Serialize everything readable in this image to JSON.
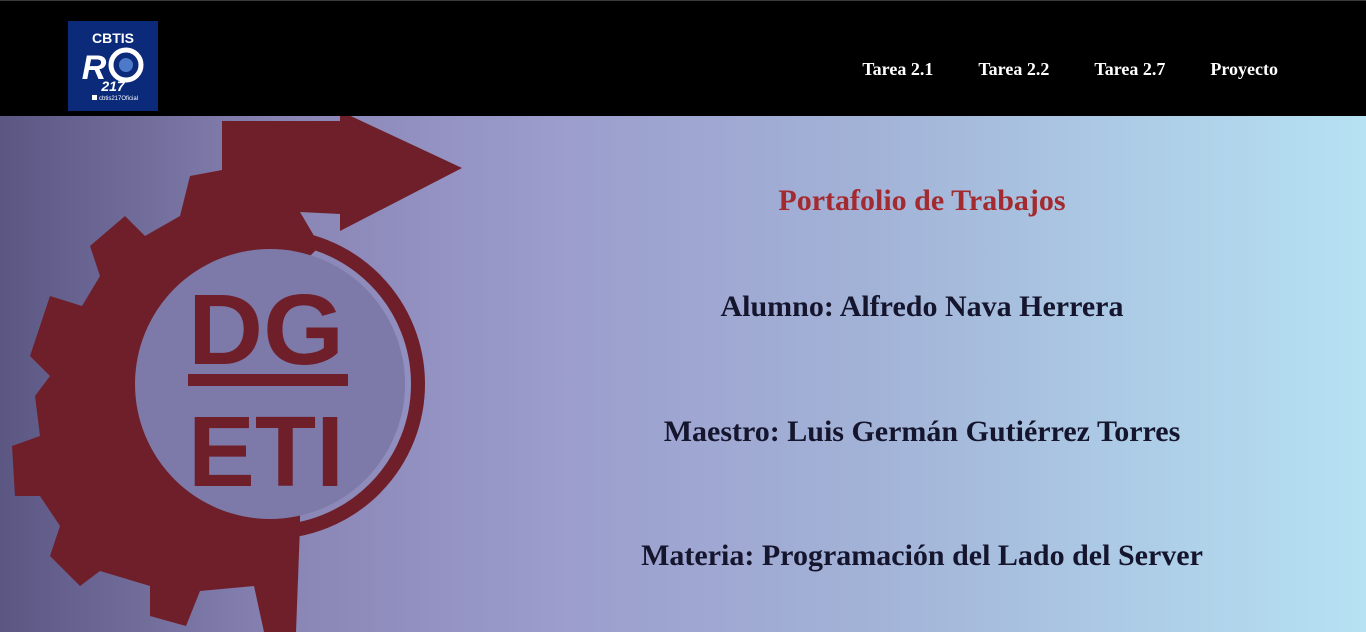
{
  "header": {
    "logo": {
      "text_top": "CBTIS",
      "text_number": "217",
      "text_bottom": "cbtis217Oficial"
    },
    "nav": [
      {
        "label": "Tarea 2.1"
      },
      {
        "label": "Tarea 2.2"
      },
      {
        "label": "Tarea 2.7"
      },
      {
        "label": "Proyecto"
      }
    ]
  },
  "hero": {
    "emblem_text": [
      "DG",
      "ETI"
    ],
    "title": "Portafolio de Trabajos",
    "alumno": {
      "label": "Alumno:",
      "value": "Alfredo Nava Herrera"
    },
    "maestro": {
      "label": "Maestro:",
      "value": "Luis Germán Gutiérrez Torres"
    },
    "materia": {
      "label": "Materia:",
      "value": "Programación del Lado del Server"
    }
  },
  "colors": {
    "topbar": "#000000",
    "title": "#a32a2e",
    "text": "#15152e",
    "emblem": "#6e1f2a",
    "logo_bg": "#0b2a7a"
  }
}
